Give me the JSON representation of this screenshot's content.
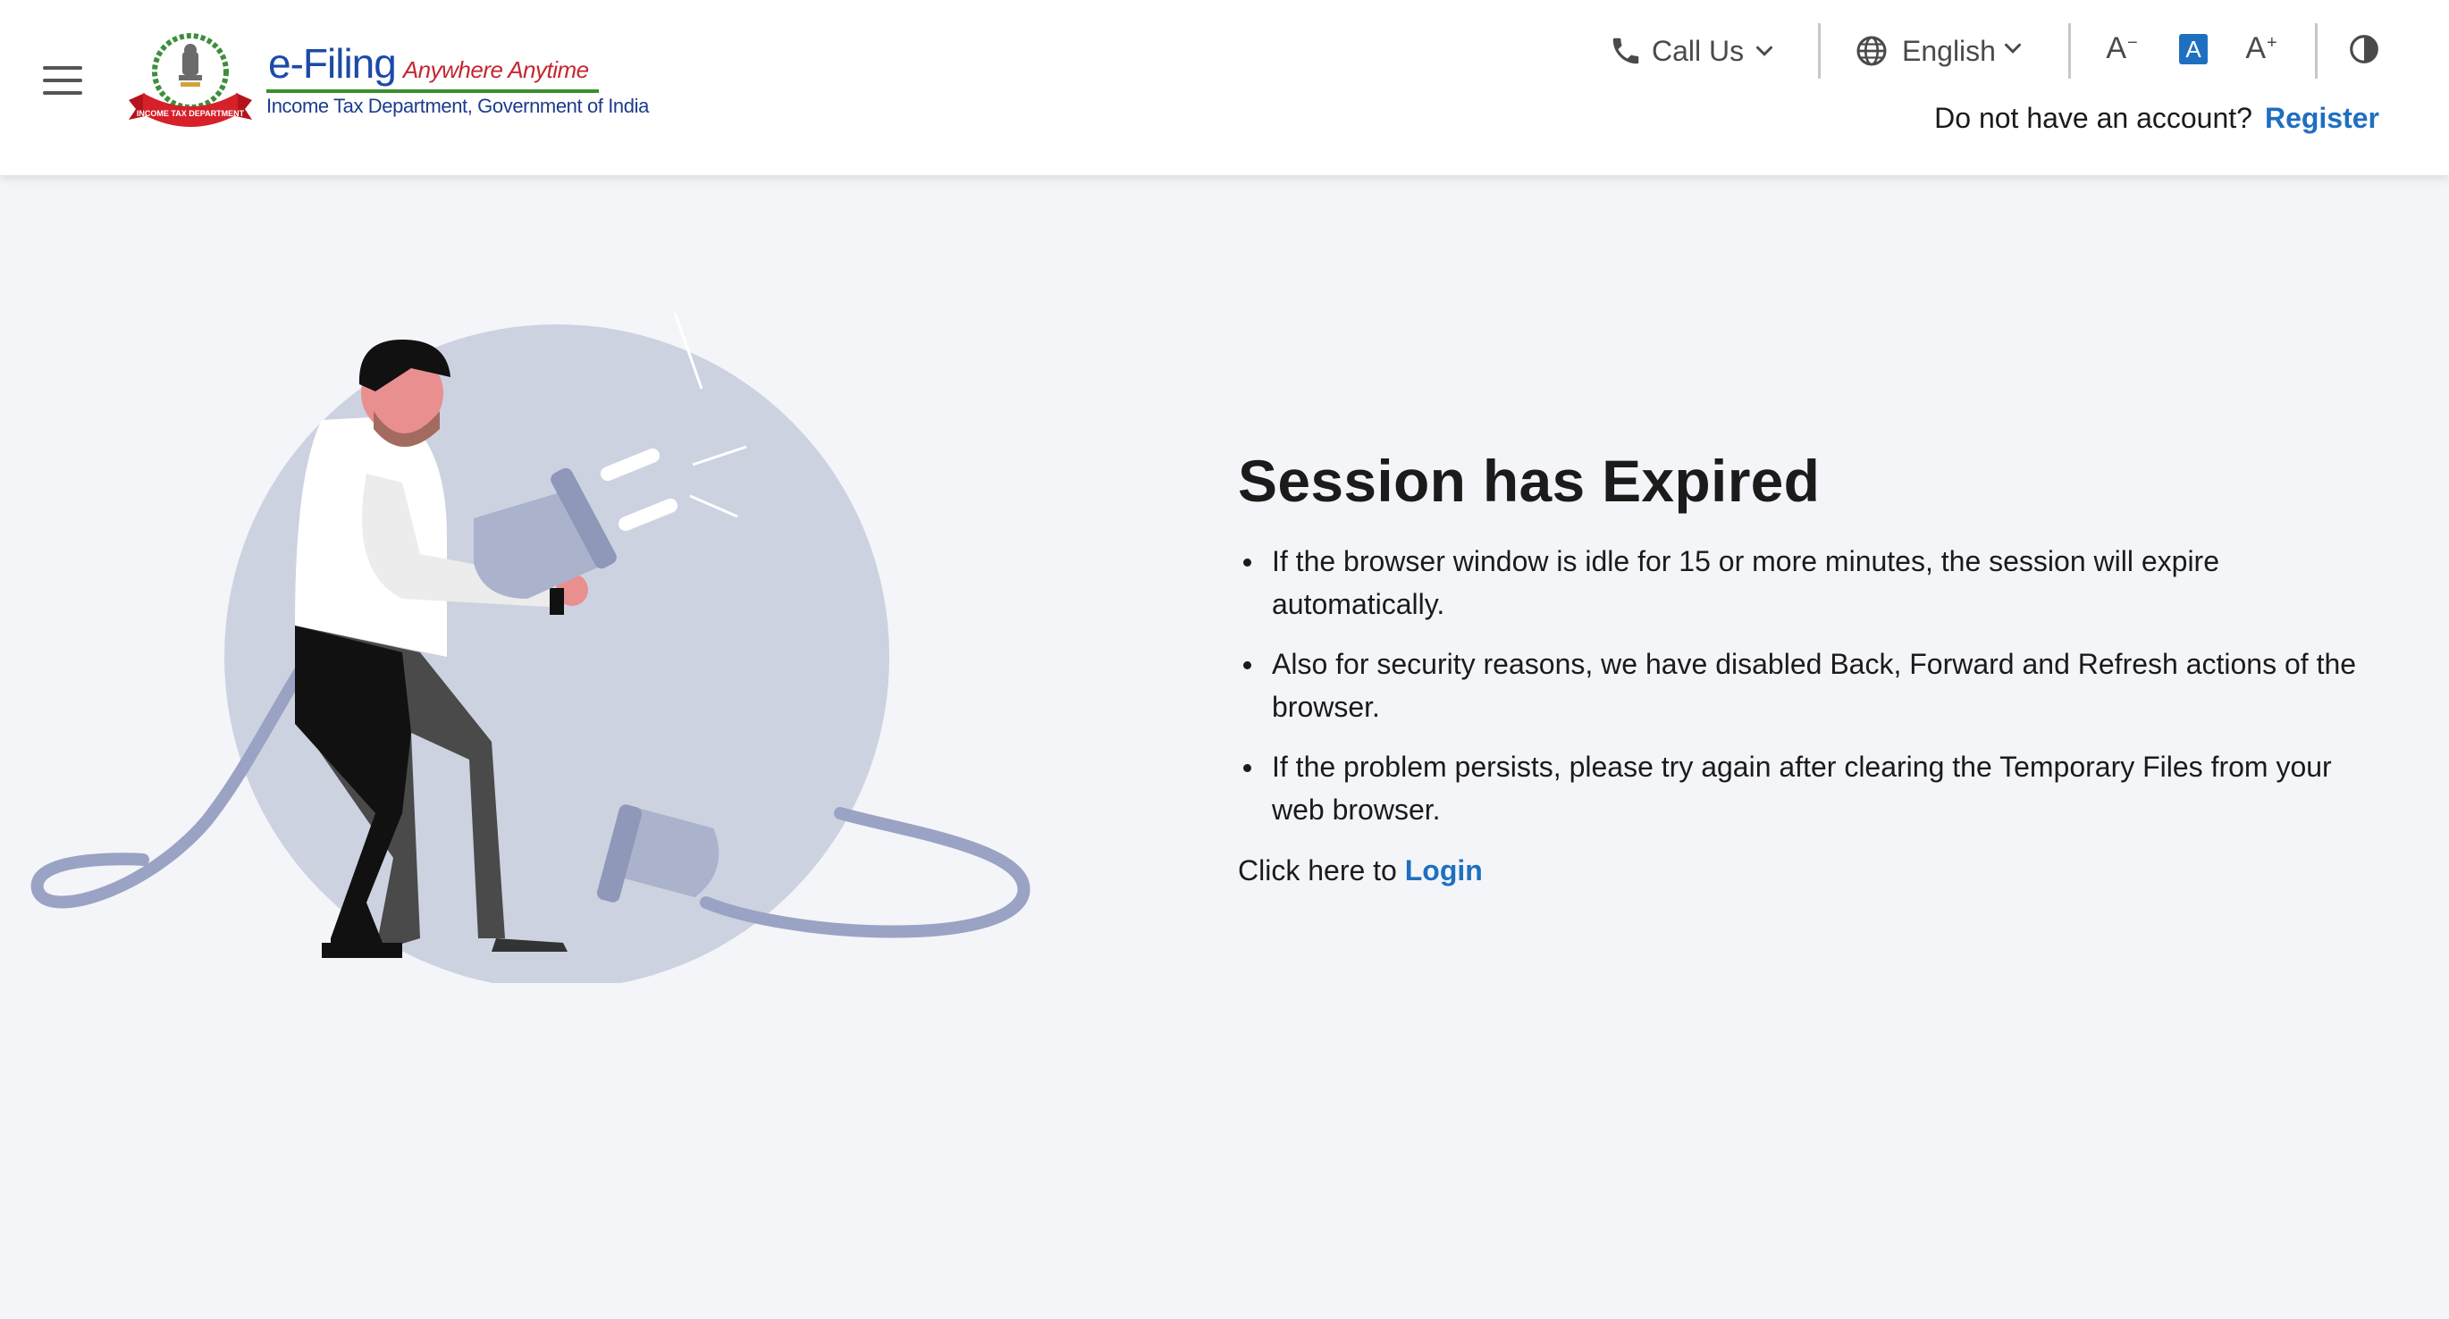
{
  "header": {
    "menu_icon": "hamburger-menu-icon",
    "logo": {
      "title": "e-Filing",
      "tagline": "Anywhere Anytime",
      "subtitle": "Income Tax Department, Government of India",
      "ribbon_text": "INCOME TAX DEPARTMENT"
    },
    "call_us": {
      "label": "Call Us",
      "icon": "phone-icon"
    },
    "language": {
      "label": "English",
      "icon": "globe-icon"
    },
    "font_controls": {
      "decrease": "A",
      "default": "A",
      "increase": "A"
    },
    "contrast_icon": "contrast-icon",
    "account_prompt": "Do not have an account?",
    "register_label": "Register"
  },
  "main": {
    "heading": "Session has Expired",
    "bullets": [
      "If the browser window is idle for 15 or more minutes, the session will expire automatically.",
      "Also for security reasons, we have disabled Back, Forward and Refresh actions of the browser.",
      "If the problem persists, please try again after clearing the Temporary Files from your web browser."
    ],
    "login_prompt": "Click here to",
    "login_label": "Login"
  },
  "colors": {
    "brand_blue": "#1f6fc1",
    "page_bg": "#f4f5f9",
    "illustration_circle": "#cdd2e1",
    "cable": "#9aa3c3"
  }
}
